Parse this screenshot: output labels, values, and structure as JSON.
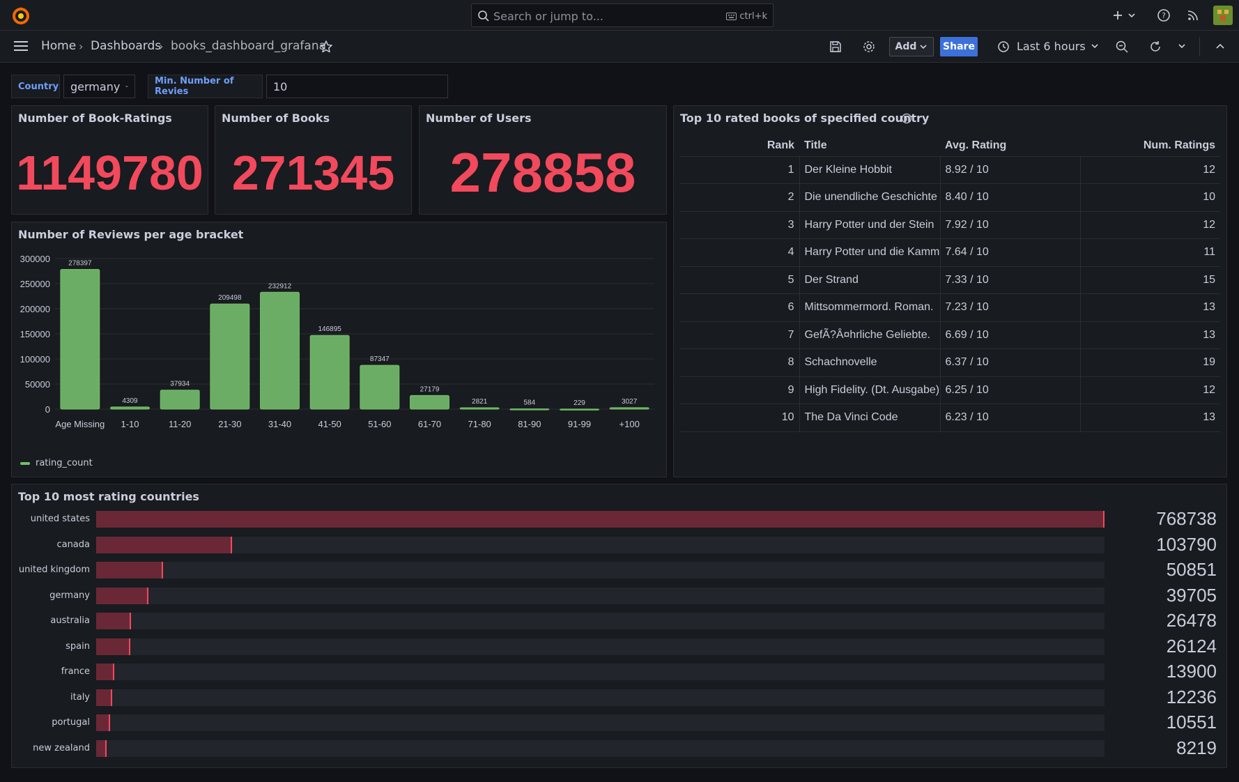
{
  "topbar": {
    "search_placeholder": "Search or jump to...",
    "search_shortcut": "ctrl+k"
  },
  "nav": {
    "home": "Home",
    "dashboards": "Dashboards",
    "dashboard_name": "books_dashboard_grafana",
    "add_label": "Add",
    "share_label": "Share",
    "time_range": "Last 6 hours"
  },
  "variables": {
    "country_label": "Country",
    "country_value": "germany",
    "min_reviews_label": "Min. Number of Revies",
    "min_reviews_value": "10"
  },
  "stats": [
    {
      "title": "Number of Book-Ratings",
      "value": "1149780"
    },
    {
      "title": "Number of Books",
      "value": "271345"
    },
    {
      "title": "Number of Users",
      "value": "278858"
    }
  ],
  "age_panel": {
    "title": "Number of Reviews per age bracket",
    "legend": "rating_count",
    "bar_color": "#73bf69"
  },
  "chart_data": {
    "type": "bar",
    "categories": [
      "Age Missing",
      "1-10",
      "11-20",
      "21-30",
      "31-40",
      "41-50",
      "51-60",
      "61-70",
      "71-80",
      "81-90",
      "91-99",
      "+100"
    ],
    "series": [
      {
        "name": "rating_count",
        "values": [
          278397,
          4309,
          37934,
          209498,
          232912,
          146895,
          87347,
          27179,
          2821,
          584,
          229,
          3027
        ]
      }
    ],
    "data_labels": [
      "278397",
      "4309",
      "37934",
      "209498",
      "232912",
      "146895",
      "87347",
      "27179",
      "2821",
      "584",
      "229",
      "3027"
    ],
    "yticks": [
      "300000",
      "250000",
      "200000",
      "150000",
      "100000",
      "50000",
      "0"
    ],
    "ylim": [
      0,
      300000
    ],
    "grid": true,
    "legend_position": "bottom-left"
  },
  "books_panel": {
    "title": "Top 10 rated books of specified country",
    "columns": [
      "Rank",
      "Title",
      "Avg. Rating",
      "Num. Ratings"
    ],
    "rows": [
      [
        "1",
        "Der Kleine Hobbit",
        "8.92 / 10",
        "12"
      ],
      [
        "2",
        "Die unendliche Geschichte",
        "8.40 / 10",
        "10"
      ],
      [
        "3",
        "Harry Potter und der Stein",
        "7.92 / 10",
        "12"
      ],
      [
        "4",
        "Harry Potter und die Kammer",
        "7.64 / 10",
        "11"
      ],
      [
        "5",
        "Der Strand",
        "7.33 / 10",
        "15"
      ],
      [
        "6",
        "Mittsommermord. Roman.",
        "7.23 / 10",
        "13"
      ],
      [
        "7",
        "GefÃ?Â¤hrliche Geliebte.",
        "6.69 / 10",
        "13"
      ],
      [
        "8",
        "Schachnovelle",
        "6.37 / 10",
        "19"
      ],
      [
        "9",
        "High Fidelity. (Dt. Ausgabe)",
        "6.25 / 10",
        "12"
      ],
      [
        "10",
        "The Da Vinci Code",
        "6.23 / 10",
        "13"
      ]
    ]
  },
  "countries_panel": {
    "title": "Top 10 most rating countries",
    "max": 768738,
    "items": [
      {
        "name": "united states",
        "value": 768738,
        "label": "768738"
      },
      {
        "name": "canada",
        "value": 103790,
        "label": "103790"
      },
      {
        "name": "united kingdom",
        "value": 50851,
        "label": "50851"
      },
      {
        "name": "germany",
        "value": 39705,
        "label": "39705"
      },
      {
        "name": "australia",
        "value": 26478,
        "label": "26478"
      },
      {
        "name": "spain",
        "value": 26124,
        "label": "26124"
      },
      {
        "name": "france",
        "value": 13900,
        "label": "13900"
      },
      {
        "name": "italy",
        "value": 12236,
        "label": "12236"
      },
      {
        "name": "portugal",
        "value": 10551,
        "label": "10551"
      },
      {
        "name": "new zealand",
        "value": 8219,
        "label": "8219"
      }
    ]
  }
}
